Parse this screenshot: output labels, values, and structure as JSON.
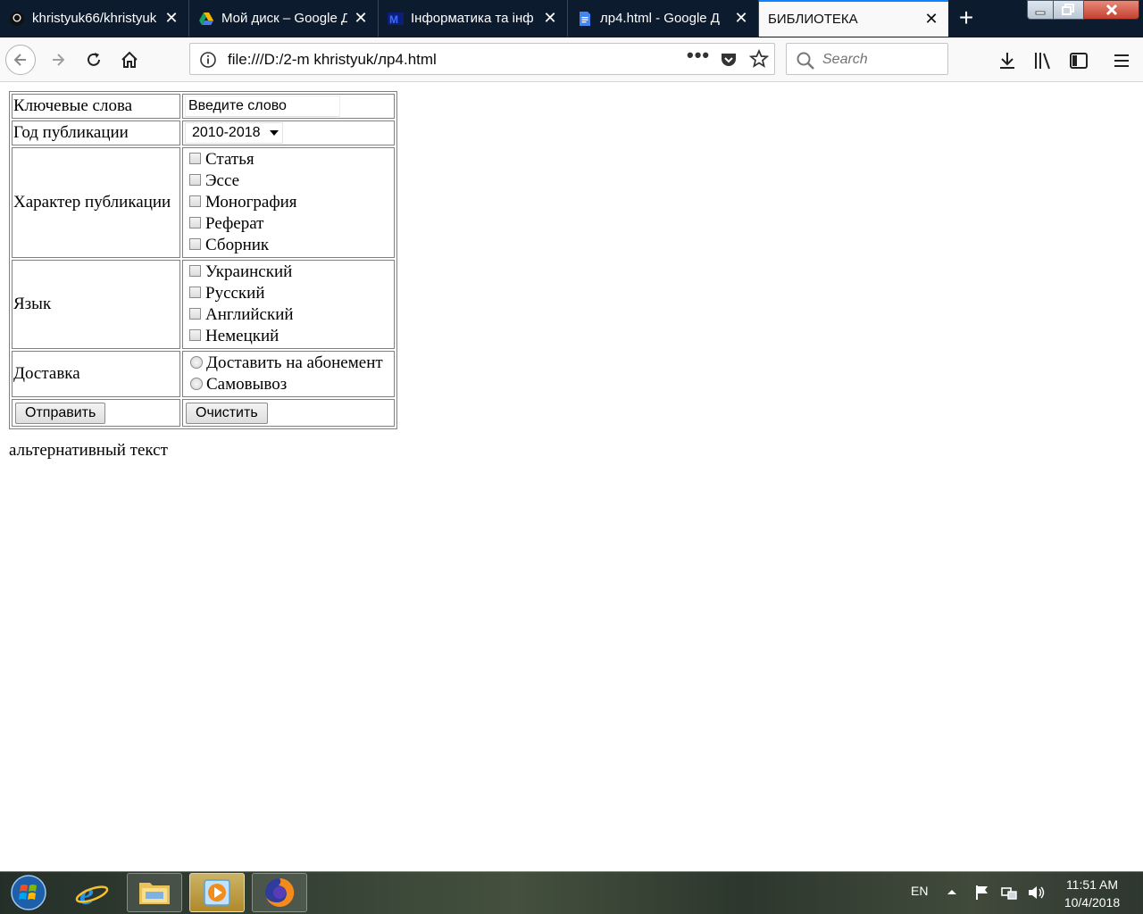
{
  "browser": {
    "tabs": [
      {
        "title": "khristyuk66/khristyuk",
        "icon": "github-icon"
      },
      {
        "title": "Мой диск – Google Д",
        "icon": "google-drive-icon"
      },
      {
        "title": "Інформатика та інф",
        "icon": "moodle-icon"
      },
      {
        "title": "лр4.html - Google Д",
        "icon": "google-docs-icon"
      },
      {
        "title": "БИБЛИОТЕКА",
        "icon": "none",
        "active": true
      }
    ],
    "close_glyph": "✕",
    "new_tab_glyph": "+",
    "url": "file:///D:/2-m khristyuk/лр4.html",
    "page_actions_glyph": "•••",
    "search_placeholder": "Search"
  },
  "form": {
    "keywords_label": "Ключевые слова",
    "keywords_value": "Введите слово",
    "year_label": "Год публикации",
    "year_selected": "2010-2018",
    "type_label": "Характер публикации",
    "type_options": [
      "Статья",
      "Эссе",
      "Монография",
      "Реферат",
      "Сборник"
    ],
    "language_label": "Язык",
    "language_options": [
      "Украинский",
      "Русский",
      "Английский",
      "Немецкий"
    ],
    "delivery_label": "Доставка",
    "delivery_options": [
      "Доставить на абонемент",
      "Самовывоз"
    ],
    "submit_label": "Отправить",
    "reset_label": "Очистить"
  },
  "alt_text": "альтернативный текст",
  "taskbar": {
    "language": "EN",
    "time": "11:51 AM",
    "date": "10/4/2018"
  },
  "colors": {
    "tabbar": "#0c1b2e",
    "active_tab_accent": "#0a84ff"
  }
}
